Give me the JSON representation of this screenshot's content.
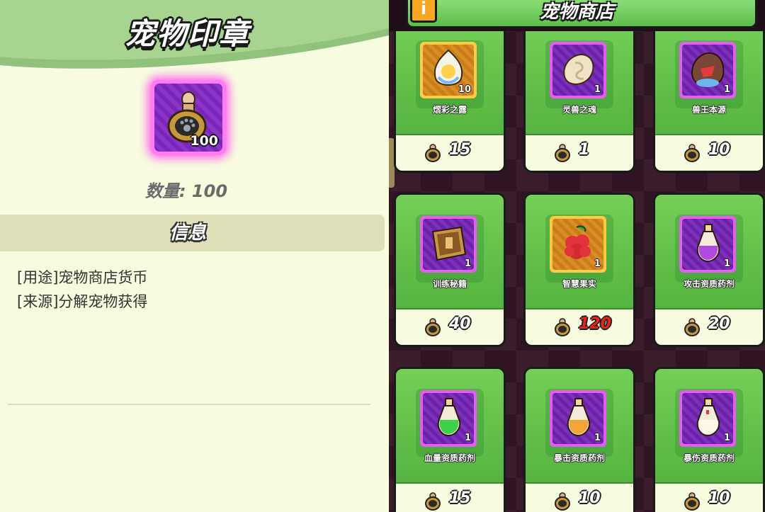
{
  "detail": {
    "title": "宠物印章",
    "item": {
      "icon": "pet-seal-icon",
      "count": "100"
    },
    "quantity": "数量: 100",
    "info_header": "信息",
    "lines": [
      "[用途]宠物商店货币",
      "[来源]分解宠物获得"
    ]
  },
  "shop": {
    "title": "宠物商店",
    "info_button": "i",
    "currency_icon": "pet-seal-icon",
    "items": [
      {
        "name": "熠彩之露",
        "count": "10",
        "price": "15",
        "frame": "gold",
        "icon": "dew-crystal-icon",
        "price_red": false
      },
      {
        "name": "灵兽之魂",
        "count": "1",
        "price": "1",
        "frame": "purple",
        "icon": "spirit-stone-icon",
        "price_red": false
      },
      {
        "name": "兽王本源",
        "count": "1",
        "price": "10",
        "frame": "purple",
        "icon": "beast-origin-icon",
        "price_red": false
      },
      {
        "name": "训练秘籍",
        "count": "1",
        "price": "40",
        "frame": "purple",
        "icon": "training-book-icon",
        "price_red": false
      },
      {
        "name": "智慧果实",
        "count": "1",
        "price": "120",
        "frame": "gold",
        "icon": "wisdom-fruit-icon",
        "price_red": true
      },
      {
        "name": "攻击资质药剂",
        "count": "1",
        "price": "20",
        "frame": "purple",
        "icon": "potion-purple-icon",
        "price_red": false
      },
      {
        "name": "血量资质药剂",
        "count": "1",
        "price": "15",
        "frame": "purple",
        "icon": "potion-green-icon",
        "price_red": false
      },
      {
        "name": "暴击资质药剂",
        "count": "1",
        "price": "10",
        "frame": "purple",
        "icon": "potion-orange-icon",
        "price_red": false
      },
      {
        "name": "暴伤资质药剂",
        "count": "1",
        "price": "10",
        "frame": "purple",
        "icon": "potion-white-icon",
        "price_red": false
      }
    ]
  },
  "colors": {
    "accent_green": "#6cc94e",
    "panel_bg": "#f7fbe0",
    "price_red": "#e8231e",
    "epic_purple": "#e65cf0",
    "legend_gold": "#ffc845"
  }
}
